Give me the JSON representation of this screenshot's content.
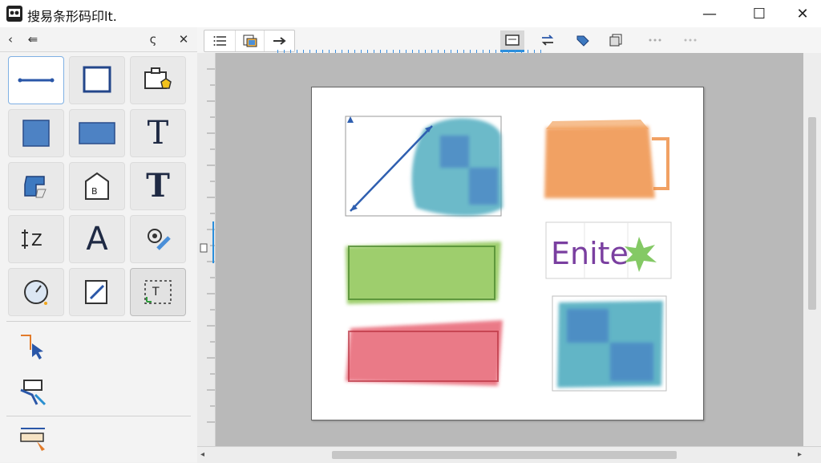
{
  "window": {
    "title": "搜易条形码印lt.",
    "controls": {
      "minimize": "—",
      "maximize": "☐",
      "close": "✕"
    }
  },
  "left_panel": {
    "header": {
      "back": "‹",
      "collapse": "⇚",
      "pin": "ς",
      "close": "✕"
    },
    "tools": [
      {
        "name": "line-tool",
        "active": true
      },
      {
        "name": "rectangle-tool"
      },
      {
        "name": "stamp-tool"
      },
      {
        "name": "square-tool"
      },
      {
        "name": "wide-rectangle-tool"
      },
      {
        "name": "text-tool",
        "glyph": "T"
      },
      {
        "name": "shape-fill-tool"
      },
      {
        "name": "barcode-tag-tool",
        "label": "B"
      },
      {
        "name": "text-bold-tool",
        "glyph": "T"
      },
      {
        "name": "line-spacing-tool",
        "label": "Z"
      },
      {
        "name": "font-tool",
        "glyph": "A"
      },
      {
        "name": "settings-edit-tool"
      },
      {
        "name": "gauge-tool"
      },
      {
        "name": "pen-edit-tool"
      },
      {
        "name": "text-frame-tool",
        "selected": true
      }
    ],
    "side_tools": [
      "select-arrow-tool",
      "layer-tool",
      "ruler-tool"
    ]
  },
  "toolbar": {
    "tabs": [
      "list-icon",
      "layout-icon",
      "arrow-right-icon"
    ],
    "icons": [
      "frame-icon",
      "swap-icon",
      "tag-icon",
      "copy-icon",
      "dots-icon",
      "more-icon"
    ]
  },
  "canvas": {
    "label_text": "Enite",
    "colors": {
      "blue_line": "#2f5fb0",
      "teal_blue": "#3aa3b8",
      "orange": "#ee8a3c",
      "green": "#86c24a",
      "red_pink": "#e65a6a",
      "page": "#ffffff",
      "canvas_bg": "#b9b9b9"
    }
  }
}
